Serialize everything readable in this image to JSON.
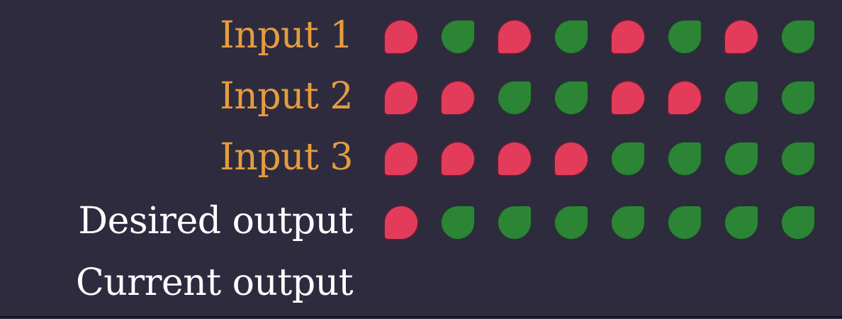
{
  "rows": [
    {
      "label": "Input 1",
      "kind": "input",
      "values": [
        "red",
        "green",
        "red",
        "green",
        "red",
        "green",
        "red",
        "green"
      ]
    },
    {
      "label": "Input 2",
      "kind": "input",
      "values": [
        "red",
        "red",
        "green",
        "green",
        "red",
        "red",
        "green",
        "green"
      ]
    },
    {
      "label": "Input 3",
      "kind": "input",
      "values": [
        "red",
        "red",
        "red",
        "red",
        "green",
        "green",
        "green",
        "green"
      ]
    },
    {
      "label": "Desired output",
      "kind": "output",
      "values": [
        "red",
        "green",
        "green",
        "green",
        "green",
        "green",
        "green",
        "green"
      ]
    },
    {
      "label": "Current output",
      "kind": "output",
      "values": []
    }
  ],
  "colors": {
    "background": "#2e2b3f",
    "input_label": "#e49d3e",
    "output_label": "#ffffff",
    "red": "#e33c5b",
    "green": "#2c8534"
  }
}
